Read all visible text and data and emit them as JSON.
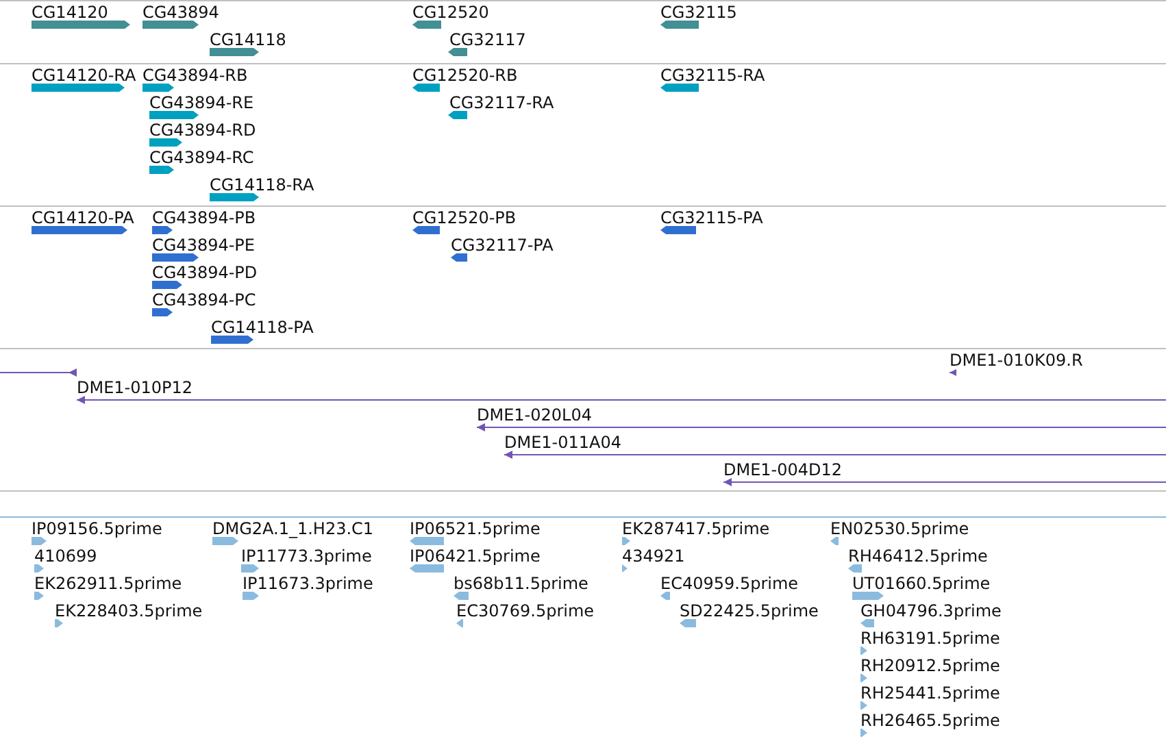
{
  "tracks": [
    {
      "kind": "gene",
      "color": "#428f94",
      "features": [
        {
          "label": "CG14120",
          "forward": true
        },
        {
          "label": "CG43894",
          "forward": true
        },
        {
          "label": "CG14118",
          "forward": true
        },
        {
          "label": "CG12520",
          "forward": false
        },
        {
          "label": "CG32117",
          "forward": false
        },
        {
          "label": "CG32115",
          "forward": false
        }
      ]
    },
    {
      "kind": "gene",
      "color": "#00a0c0",
      "features": [
        {
          "label": "CG14120-RA",
          "forward": true
        },
        {
          "label": "CG43894-RB",
          "forward": true
        },
        {
          "label": "CG43894-RE",
          "forward": true
        },
        {
          "label": "CG43894-RD",
          "forward": true
        },
        {
          "label": "CG43894-RC",
          "forward": true
        },
        {
          "label": "CG14118-RA",
          "forward": true
        },
        {
          "label": "CG12520-RB",
          "forward": false
        },
        {
          "label": "CG32117-RA",
          "forward": false
        },
        {
          "label": "CG32115-RA",
          "forward": false
        }
      ]
    },
    {
      "kind": "gene",
      "color": "#2f6fd0",
      "features": [
        {
          "label": "CG14120-PA",
          "forward": true
        },
        {
          "label": "CG43894-PB",
          "forward": true
        },
        {
          "label": "CG43894-PE",
          "forward": true
        },
        {
          "label": "CG43894-PD",
          "forward": true
        },
        {
          "label": "CG43894-PC",
          "forward": true
        },
        {
          "label": "CG14118-PA",
          "forward": true
        },
        {
          "label": "CG12520-PB",
          "forward": false
        },
        {
          "label": "CG32117-PA",
          "forward": false
        },
        {
          "label": "CG32115-PA",
          "forward": false
        }
      ]
    },
    {
      "kind": "clone",
      "color": "#7155b5",
      "features": [
        {
          "forward": false
        },
        {
          "label": "DME1-010K09.R",
          "forward": false
        },
        {
          "label": "DME1-010P12",
          "forward": false
        },
        {
          "label": "DME1-020L04",
          "forward": false
        },
        {
          "label": "DME1-011A04",
          "forward": false
        },
        {
          "label": "DME1-004D12",
          "forward": false
        }
      ]
    },
    {
      "kind": "gene",
      "color": "#8abbdf",
      "features": [
        {
          "label": "IP09156.5prime",
          "forward": true
        },
        {
          "label": "410699",
          "forward": true
        },
        {
          "label": "EK262911.5prime",
          "forward": true
        },
        {
          "label": "EK228403.5prime",
          "forward": true
        },
        {
          "label": "DMG2A.1_1.H23.C1",
          "forward": true
        },
        {
          "label": "IP11773.3prime",
          "forward": true
        },
        {
          "label": "IP11673.3prime",
          "forward": true
        },
        {
          "label": "IP06521.5prime",
          "forward": false
        },
        {
          "label": "IP06421.5prime",
          "forward": false
        },
        {
          "label": "bs68b11.5prime",
          "forward": false
        },
        {
          "label": "EC30769.5prime",
          "forward": false
        },
        {
          "label": "EK287417.5prime",
          "forward": true
        },
        {
          "label": "434921",
          "forward": true
        },
        {
          "label": "EC40959.5prime",
          "forward": false
        },
        {
          "label": "SD22425.5prime",
          "forward": false
        },
        {
          "label": "EN02530.5prime",
          "forward": false
        },
        {
          "label": "RH46412.5prime",
          "forward": false
        },
        {
          "label": "UT01660.5prime",
          "forward": true
        },
        {
          "label": "GH04796.3prime",
          "forward": false
        },
        {
          "label": "RH63191.5prime",
          "forward": true
        },
        {
          "label": "RH20912.5prime",
          "forward": true
        },
        {
          "label": "RH25441.5prime",
          "forward": true
        },
        {
          "label": "RH26465.5prime",
          "forward": true
        }
      ]
    }
  ]
}
